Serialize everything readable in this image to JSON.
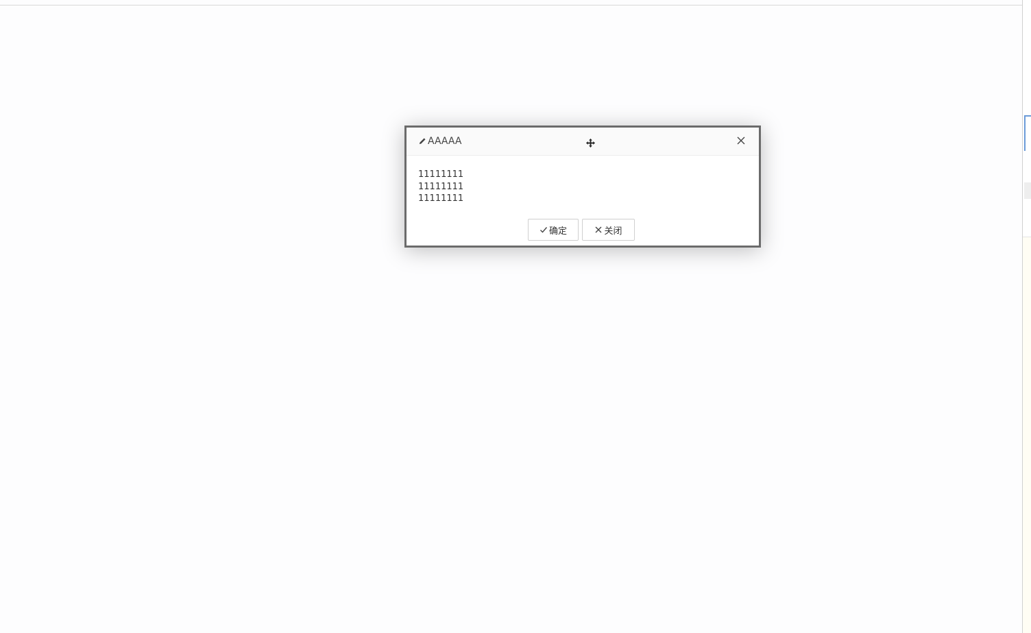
{
  "dialog": {
    "title": "AAAAA",
    "title_icon": "pencil-icon",
    "move_icon": "move-icon",
    "close_icon": "close-icon",
    "body_lines": [
      "11111111",
      "11111111",
      "11111111"
    ],
    "buttons": {
      "confirm_label": "确定",
      "confirm_icon": "check-icon",
      "close_label": "关闭",
      "close_icon": "close-icon"
    }
  },
  "colors": {
    "dialog_border": "#6b6b6b",
    "page_background": "#fdfdfe"
  }
}
